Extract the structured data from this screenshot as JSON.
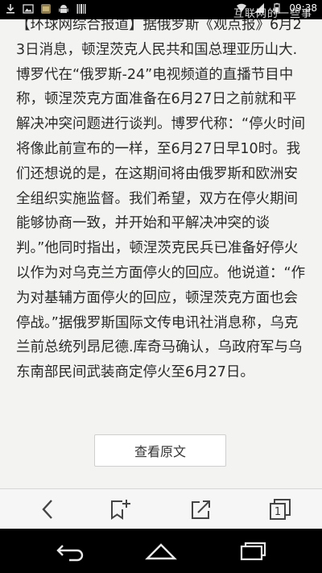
{
  "status_bar": {
    "time": "09:38",
    "icons": [
      "download-icon",
      "image-icon",
      "app-icon",
      "android-icon",
      "barcode-icon",
      "wifi-icon",
      "signal-icon",
      "battery-icon"
    ]
  },
  "watermark": "互联网的一些事",
  "article": {
    "text": "【环球网综合报道】据俄罗斯《观点报》6月23日消息，顿涅茨克人民共和国总理亚历山大.博罗代在“俄罗斯-24”电视频道的直播节目中称，顿涅茨克方面准备在6月27日之前就和平解决冲突问题进行谈判。博罗代称：“停火时间将像此前宣布的一样，至6月27日早10时。我们还想说的是，在这期间将由俄罗斯和欧洲安全组织实施监督。我们希望，双方在停火期间能够协商一致，并开始和平解决冲突的谈判。”他同时指出，顿涅茨克民兵已准备好停火以作为对乌克兰方面停火的回应。他说道：“作为对基辅方面停火的回应，顿涅茨克方面也会停战。”据俄罗斯国际文传电讯社消息称，乌克兰前总统列昂尼德.库奇马确认，乌政府军与乌东南部民间武装商定停火至6月27日。"
  },
  "view_original_label": "查看原文",
  "toolbar": {
    "tab_count": "1",
    "buttons": [
      "back-icon",
      "bookmark-add-icon",
      "share-icon",
      "tabs-icon"
    ]
  },
  "nav_bar": {
    "buttons": [
      "back-nav-icon",
      "home-nav-icon",
      "recent-apps-icon"
    ]
  }
}
